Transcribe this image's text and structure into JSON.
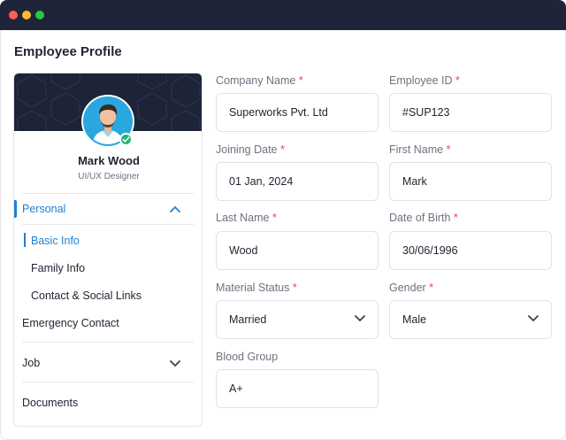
{
  "page": {
    "title": "Employee Profile"
  },
  "profile": {
    "name": "Mark Wood",
    "role": "UI/UX Designer",
    "avatar_icon": "avatar-photo",
    "verified_icon": "check-icon"
  },
  "nav": {
    "personal": "Personal",
    "sub_items": [
      "Basic Info",
      "Family Info",
      "Contact & Social Links"
    ],
    "emergency": "Emergency Contact",
    "job": "Job",
    "documents": "Documents"
  },
  "form": {
    "company_name": {
      "label": "Company Name",
      "value": "Superworks Pvt. Ltd",
      "required": "*"
    },
    "employee_id": {
      "label": "Employee ID",
      "value": "#SUP123",
      "required": "*"
    },
    "joining_date": {
      "label": "Joining Date",
      "value": "01 Jan, 2024",
      "required": "*"
    },
    "first_name": {
      "label": "First Name",
      "value": "Mark",
      "required": "*"
    },
    "last_name": {
      "label": "Last Name",
      "value": "Wood",
      "required": "*"
    },
    "dob": {
      "label": "Date of Birth",
      "value": "30/06/1996",
      "required": "*"
    },
    "marital_status": {
      "label": "Material Status",
      "value": "Married",
      "required": "*"
    },
    "gender": {
      "label": "Gender",
      "value": "Male",
      "required": "*"
    },
    "blood_group": {
      "label": "Blood Group",
      "value": "A+"
    }
  },
  "colors": {
    "accent": "#1f7fd6",
    "titlebar": "#1f2438",
    "required": "#e5484d",
    "verified": "#22b573"
  }
}
